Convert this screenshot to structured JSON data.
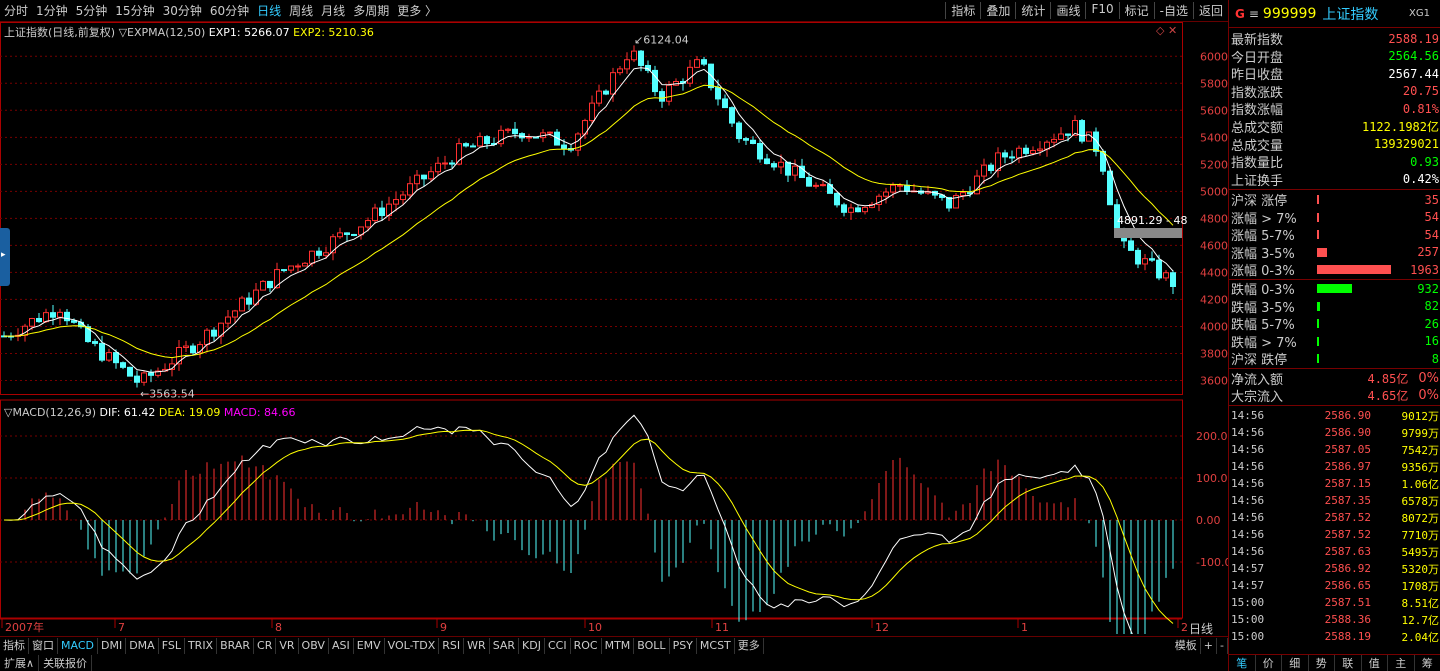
{
  "toolbar": {
    "timeframes": [
      "分时",
      "1分钟",
      "5分钟",
      "15分钟",
      "30分钟",
      "60分钟",
      "日线",
      "周线",
      "月线",
      "多周期",
      "更多 〉"
    ],
    "active_index": 6,
    "tools": [
      "指标",
      "叠加",
      "统计",
      "画线",
      "F10",
      "标记",
      "-自选",
      "返回"
    ]
  },
  "main_legend": {
    "title": "上证指数(日线,前复权)",
    "indicator": "▽EXPMA(12,50)",
    "exp1": "EXP1: 5266.07",
    "exp2": "EXP2: 5210.36"
  },
  "macd_legend": {
    "indicator": "▽MACD(12,26,9)",
    "dif": "DIF: 61.42",
    "dea": "DEA: 19.09",
    "macd": "MACD: 84.66"
  },
  "price_axis": [
    "6000",
    "5800",
    "5600",
    "5400",
    "5200",
    "5000",
    "4800",
    "4600",
    "4400",
    "4200",
    "4000",
    "3800",
    "3600"
  ],
  "macd_axis": [
    "200.0",
    "100.0",
    "0.00",
    "-100.0"
  ],
  "annotations": {
    "high": "6124.04",
    "low": "←3563.54",
    "last": "4891.29 - 48"
  },
  "months": [
    "2007年",
    "7",
    "8",
    "9",
    "10",
    "11",
    "12",
    "1",
    "2"
  ],
  "bottom_tabs": [
    "指标",
    "窗口",
    "MACD",
    "DMI",
    "DMA",
    "FSL",
    "TRIX",
    "BRAR",
    "CR",
    "VR",
    "OBV",
    "ASI",
    "EMV",
    "VOL-TDX",
    "RSI",
    "WR",
    "SAR",
    "KDJ",
    "CCI",
    "ROC",
    "MTM",
    "BOLL",
    "PSY",
    "MCST",
    "更多"
  ],
  "bottom_active": 2,
  "bottom_right": [
    "模板",
    "+",
    "-"
  ],
  "bottom2": [
    "扩展∧",
    "关联报价"
  ],
  "chart_data": {
    "type": "candlestick",
    "title": "上证指数(日线,前复权)",
    "high": 6124.04,
    "low": 3563.54,
    "ylim": [
      3500,
      6150
    ],
    "exp1": 5266.07,
    "exp2": 5210.36,
    "dif": 61.42,
    "dea": 19.09,
    "macd": 84.66
  },
  "sidebar": {
    "logo": "G",
    "menu": "≡",
    "code": "999999",
    "name": "上证指数",
    "tag": "XG1",
    "stats": [
      {
        "label": "最新指数",
        "value": "2588.19",
        "color": "#ff5050"
      },
      {
        "label": "今日开盘",
        "value": "2564.56",
        "color": "#00ff00"
      },
      {
        "label": "昨日收盘",
        "value": "2567.44",
        "color": "#ffffff"
      },
      {
        "label": "指数涨跌",
        "value": "20.75",
        "color": "#ff5050"
      },
      {
        "label": "指数涨幅",
        "value": "0.81%",
        "color": "#ff5050"
      },
      {
        "label": "总成交额",
        "value": "1122.1982亿",
        "color": "#ffff00"
      },
      {
        "label": "总成交量",
        "value": "139329021",
        "color": "#ffff00"
      },
      {
        "label": "指数量比",
        "value": "0.93",
        "color": "#00ff00"
      },
      {
        "label": "上证换手",
        "value": "0.42%",
        "color": "#ffffff"
      }
    ],
    "breadth": [
      {
        "label": "沪深 涨停",
        "value": "35",
        "color": "#ff5050",
        "bar": 0.01
      },
      {
        "label": "涨幅 > 7%",
        "value": "54",
        "color": "#ff5050",
        "bar": 0.02
      },
      {
        "label": "涨幅 5-7%",
        "value": "54",
        "color": "#ff5050",
        "bar": 0.02
      },
      {
        "label": "涨幅 3-5%",
        "value": "257",
        "color": "#ff5050",
        "bar": 0.13
      },
      {
        "label": "涨幅 0-3%",
        "value": "1963",
        "color": "#ff5050",
        "bar": 1.0
      },
      {
        "label": "跌幅 0-3%",
        "value": "932",
        "color": "#00ff00",
        "bar": 0.47
      },
      {
        "label": "跌幅 3-5%",
        "value": "82",
        "color": "#00ff00",
        "bar": 0.04
      },
      {
        "label": "跌幅 5-7%",
        "value": "26",
        "color": "#00ff00",
        "bar": 0.01
      },
      {
        "label": "跌幅 > 7%",
        "value": "16",
        "color": "#00ff00",
        "bar": 0.01
      },
      {
        "label": "沪深 跌停",
        "value": "8",
        "color": "#00ff00",
        "bar": 0.005
      }
    ],
    "flows": [
      {
        "label": "净流入额",
        "value": "4.85亿",
        "pct": "0%"
      },
      {
        "label": "大宗流入",
        "value": "4.65亿",
        "pct": "0%"
      }
    ],
    "ticks": [
      {
        "t": "14:56",
        "p": "2586.90",
        "v": "9012万"
      },
      {
        "t": "14:56",
        "p": "2586.90",
        "v": "9799万"
      },
      {
        "t": "14:56",
        "p": "2587.05",
        "v": "7542万"
      },
      {
        "t": "14:56",
        "p": "2586.97",
        "v": "9356万"
      },
      {
        "t": "14:56",
        "p": "2587.15",
        "v": "1.06亿"
      },
      {
        "t": "14:56",
        "p": "2587.35",
        "v": "6578万"
      },
      {
        "t": "14:56",
        "p": "2587.52",
        "v": "8072万"
      },
      {
        "t": "14:56",
        "p": "2587.52",
        "v": "7710万"
      },
      {
        "t": "14:56",
        "p": "2587.63",
        "v": "5495万"
      },
      {
        "t": "14:57",
        "p": "2586.92",
        "v": "5320万"
      },
      {
        "t": "14:57",
        "p": "2586.65",
        "v": "1708万"
      },
      {
        "t": "15:00",
        "p": "2587.51",
        "v": "8.51亿"
      },
      {
        "t": "15:00",
        "p": "2588.36",
        "v": "12.7亿"
      },
      {
        "t": "15:00",
        "p": "2588.19",
        "v": "2.04亿"
      }
    ],
    "side_label": "日线",
    "tabs": [
      "笔",
      "价",
      "细",
      "势",
      "联",
      "值",
      "主",
      "筹"
    ]
  }
}
